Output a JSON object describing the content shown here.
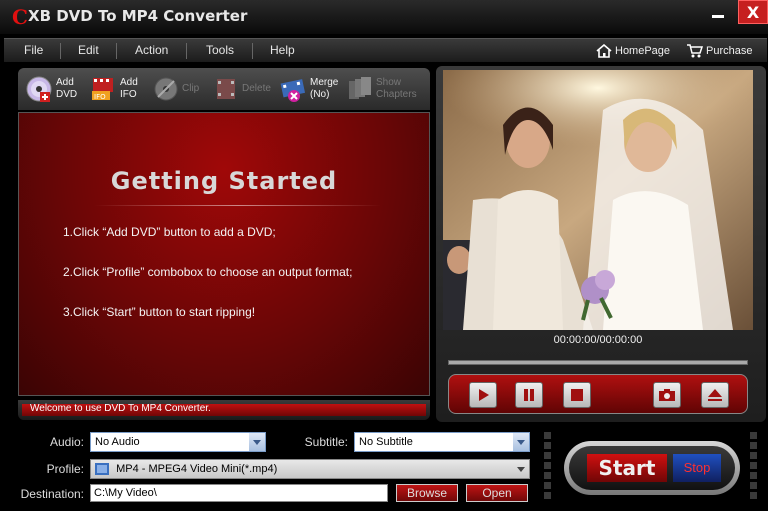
{
  "window": {
    "logo_letter": "C",
    "title": "XB DVD To MP4 Converter",
    "close_glyph": "X"
  },
  "menu": {
    "items": [
      {
        "label": "File"
      },
      {
        "label": "Edit"
      },
      {
        "label": "Action"
      },
      {
        "label": "Tools"
      },
      {
        "label": "Help"
      }
    ],
    "homepage": "HomePage",
    "purchase": "Purchase"
  },
  "toolbar": {
    "add_dvd": [
      "Add",
      "DVD"
    ],
    "add_ifo": [
      "Add",
      "IFO"
    ],
    "clip": "Clip",
    "delete": "Delete",
    "merge": [
      "Merge",
      "(No)"
    ],
    "show_chapters": [
      "Show",
      "Chapters"
    ]
  },
  "getting_started": {
    "title": "Getting  Started",
    "steps": [
      "1.Click “Add DVD” button to add a DVD;",
      "2.Click “Profile” combobox to choose an output format;",
      "3.Click “Start” button to start ripping!"
    ]
  },
  "status": {
    "text": "Welcome to use DVD To MP4 Converter."
  },
  "player": {
    "time": "00:00:00/00:00:00"
  },
  "settings": {
    "audio_label": "Audio:",
    "audio_value": "No Audio",
    "subtitle_label": "Subtitle:",
    "subtitle_value": "No Subtitle",
    "profile_label": "Profile:",
    "profile_value": "MP4 - MPEG4 Video Mini(*.mp4)",
    "destination_label": "Destination:",
    "destination_value": "C:\\My Video\\",
    "browse": "Browse",
    "open": "Open"
  },
  "actions": {
    "start": "Start",
    "stop": "Stop"
  },
  "colors": {
    "accent_red": "#c01010",
    "panel_red": "#8a0606",
    "close_red": "#c62020"
  }
}
